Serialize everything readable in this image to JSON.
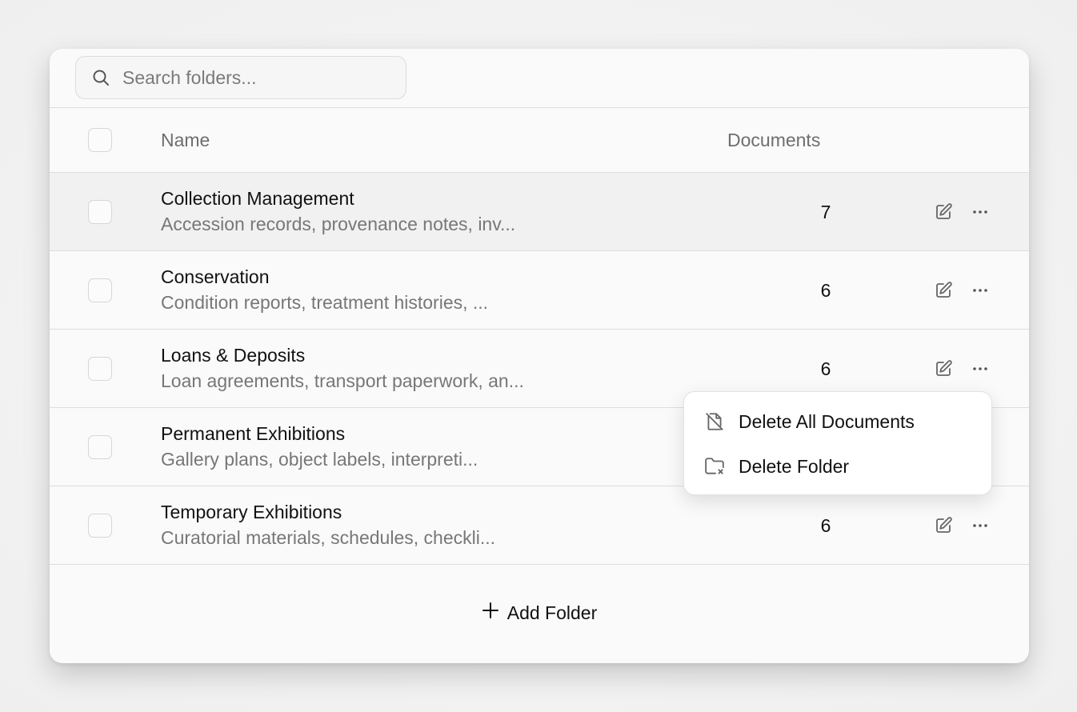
{
  "search": {
    "placeholder": "Search folders..."
  },
  "table": {
    "columns": {
      "name": "Name",
      "documents": "Documents"
    },
    "rows": [
      {
        "name": "Collection Management",
        "description": "Accession records, provenance notes, inv...",
        "documents": "7"
      },
      {
        "name": "Conservation",
        "description": "Condition reports, treatment histories, ...",
        "documents": "6"
      },
      {
        "name": "Loans & Deposits",
        "description": "Loan agreements, transport paperwork, an...",
        "documents": "6"
      },
      {
        "name": "Permanent Exhibitions",
        "description": "Gallery plans, object labels, interpreti...",
        "documents": ""
      },
      {
        "name": "Temporary Exhibitions",
        "description": "Curatorial materials, schedules, checkli...",
        "documents": "6"
      }
    ]
  },
  "context_menu": {
    "items": [
      {
        "label": "Delete All Documents",
        "icon": "file-off-icon"
      },
      {
        "label": "Delete Folder",
        "icon": "folder-x-icon"
      }
    ]
  },
  "footer": {
    "add_label": "Add Folder",
    "add_icon": "plus-icon"
  },
  "colors": {
    "background": "#f3f3f3",
    "panel": "#fafafa",
    "row_hover": "#f1f1f1",
    "text_primary": "#111111",
    "text_secondary": "#777777"
  }
}
